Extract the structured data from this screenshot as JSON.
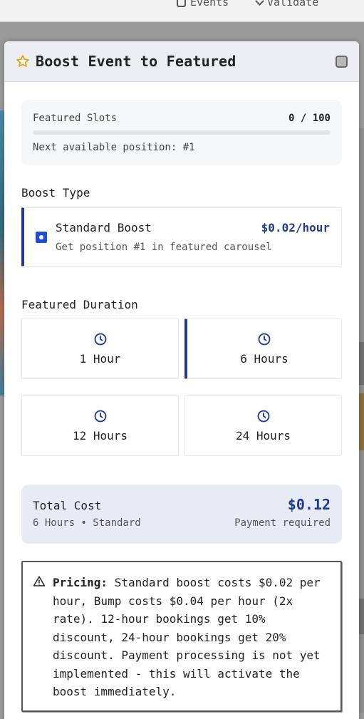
{
  "background": {
    "nav": [
      {
        "label": "Events"
      },
      {
        "label": "Validate"
      }
    ]
  },
  "modal": {
    "title": "Boost Event to Featured",
    "icons": {
      "title_icon": "star-icon",
      "close_icon": "close-icon"
    }
  },
  "slots": {
    "label": "Featured Slots",
    "count": "0 / 100",
    "fill_fraction": 0,
    "next_position": "Next available position: #1"
  },
  "boost_type": {
    "label": "Boost Type",
    "option": {
      "name": "Standard Boost",
      "price": "$0.02/hour",
      "description": "Get position #1 in featured carousel",
      "selected": true
    }
  },
  "duration": {
    "label": "Featured Duration",
    "options": [
      {
        "label": "1 Hour",
        "selected": false
      },
      {
        "label": "6 Hours",
        "selected": true
      },
      {
        "label": "12 Hours",
        "selected": false
      },
      {
        "label": "24 Hours",
        "selected": false
      }
    ]
  },
  "total": {
    "label": "Total Cost",
    "amount": "$0.12",
    "summary": "6 Hours • Standard",
    "status": "Payment required"
  },
  "pricing_note": {
    "strong": "Pricing:",
    "text": " Standard boost costs $0.02 per hour, Bump costs $0.04 per hour (2x rate). 12-hour bookings get 10% discount, 24-hour bookings get 20% discount. Payment processing is not yet implemented - this will activate the boost immediately."
  },
  "colors": {
    "accent": "#1f3a93",
    "radio": "#1f4fd1",
    "total_bg": "#e7ebf5"
  }
}
